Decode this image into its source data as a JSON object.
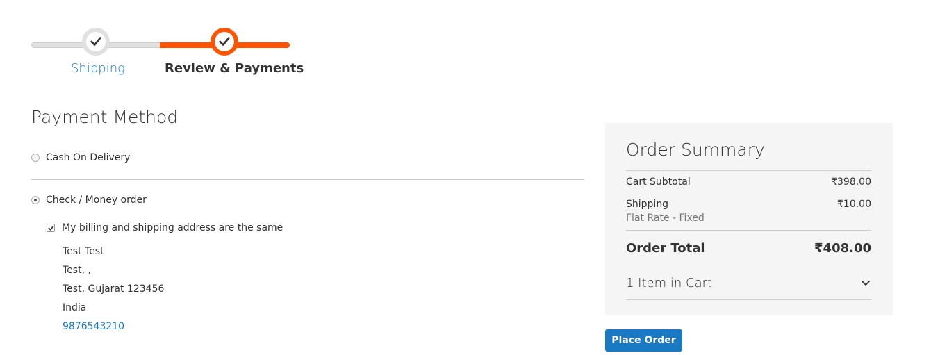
{
  "progress": {
    "steps": [
      {
        "label": "Shipping",
        "state": "complete"
      },
      {
        "label": "Review & Payments",
        "state": "active"
      }
    ]
  },
  "payment": {
    "title": "Payment Method",
    "options": [
      {
        "label": "Cash On Delivery",
        "selected": false
      },
      {
        "label": "Check / Money order",
        "selected": true
      }
    ],
    "billing_same_label": "My billing and shipping address are the same",
    "billing_same_checked": true,
    "address": {
      "name": "Test Test",
      "street": "Test, ,",
      "city_region_zip": "Test, Gujarat 123456",
      "country": "India",
      "phone": "9876543210"
    }
  },
  "summary": {
    "title": "Order Summary",
    "subtotal_label": "Cart Subtotal",
    "subtotal_value": "₹398.00",
    "shipping_label": "Shipping",
    "shipping_method": "Flat Rate - Fixed",
    "shipping_value": "₹10.00",
    "total_label": "Order Total",
    "total_value": "₹408.00",
    "items_label": "1 Item in Cart"
  },
  "actions": {
    "place_order_label": "Place Order"
  },
  "colors": {
    "accent_orange": "#ff5501",
    "link_blue": "#1979c3",
    "summary_bg": "#f5f5f5"
  }
}
